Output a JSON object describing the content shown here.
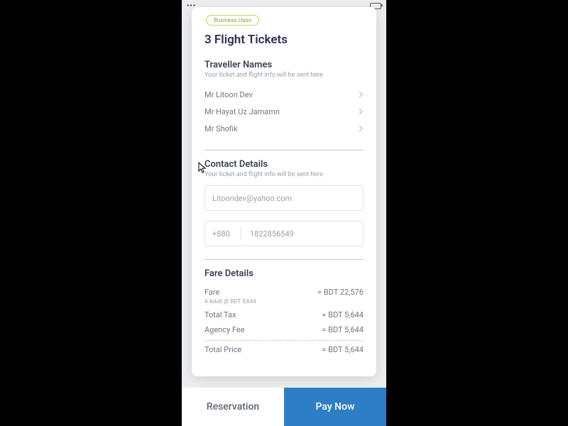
{
  "badge": "Business class",
  "title": "3 Flight Tickets",
  "travellers": {
    "heading": "Traveller Names",
    "hint": "Your ticket and flight info will be sent here",
    "items": [
      "Mr Litoon Dev",
      "Mr Hayat Uz Jamamn",
      "Mr Shofik"
    ]
  },
  "contact": {
    "heading": "Contact Details",
    "hint": "Your ticket and flight info will be sent here",
    "email": "Litoondev@yahoo.com",
    "dial_code": "+880",
    "phone": "1822856549"
  },
  "fare": {
    "heading": "Fare Details",
    "items": [
      {
        "label": "Fare",
        "value": "= BDT 22,576",
        "sub": "4 Adult @ BDT 5,644"
      },
      {
        "label": "Total Tax",
        "value": "= BDT 5,644"
      },
      {
        "label": "Agency Fee",
        "value": "= BDT 5,644"
      }
    ],
    "total": {
      "label": "Total Price",
      "value": "= BDT 5,644"
    }
  },
  "buttons": {
    "reservation": "Reservation",
    "pay": "Pay Now"
  }
}
